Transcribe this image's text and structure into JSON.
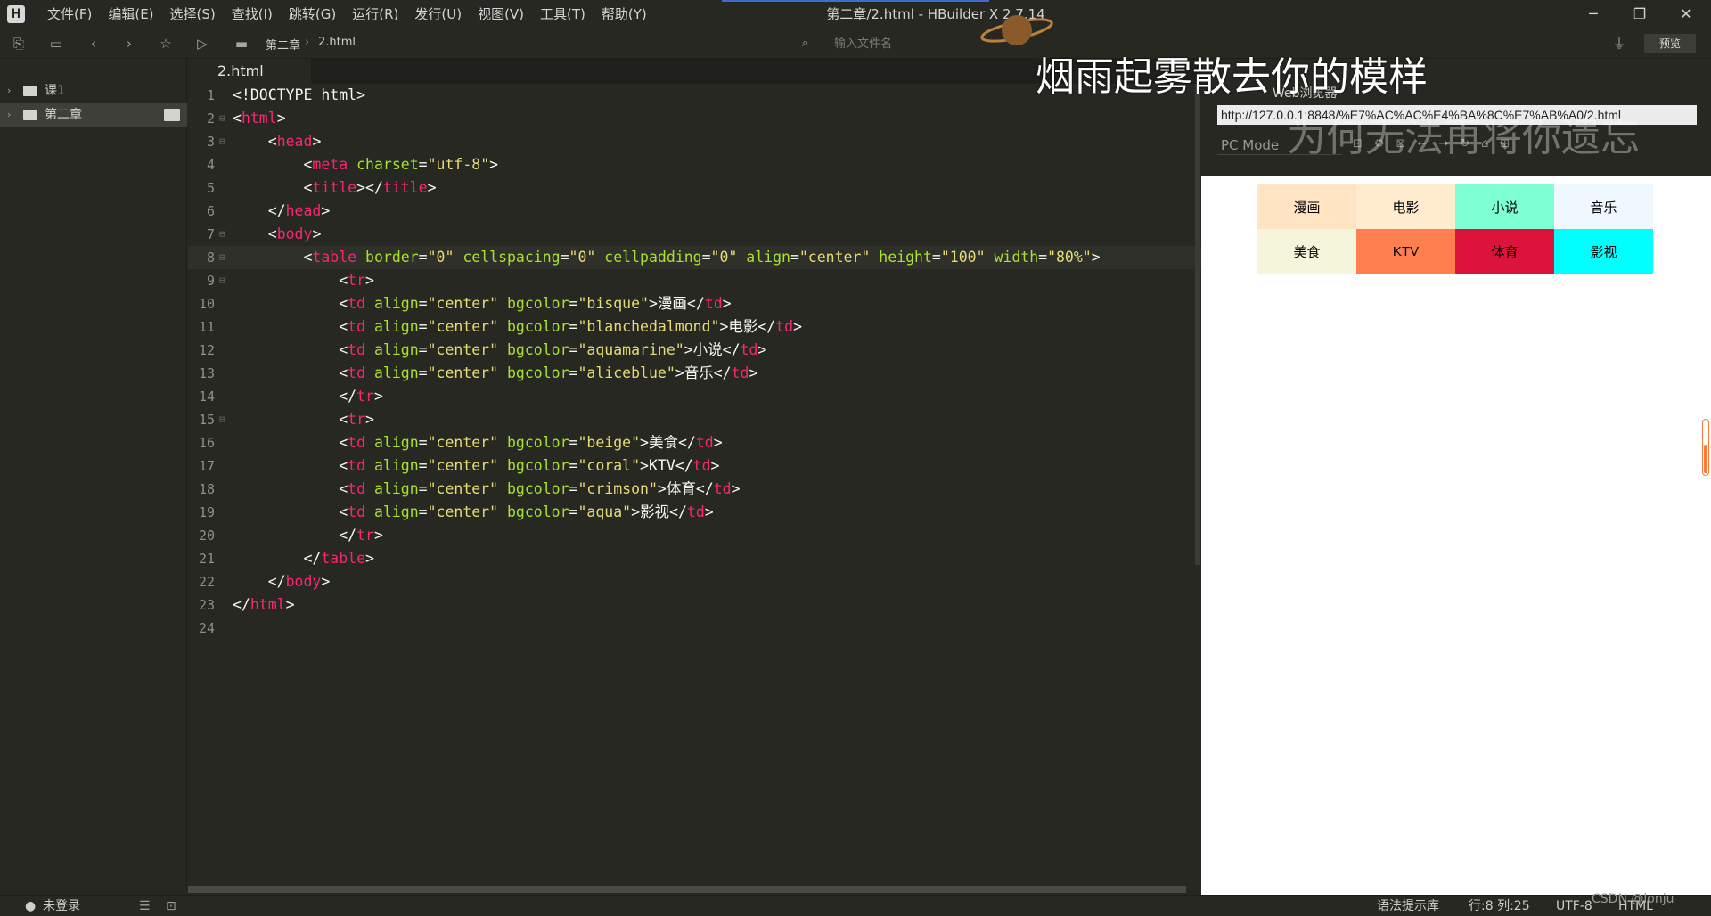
{
  "app": {
    "window_title": "第二章/2.html - HBuilder X 2.7.14",
    "menu": [
      "文件(F)",
      "编辑(E)",
      "选择(S)",
      "查找(I)",
      "跳转(G)",
      "运行(R)",
      "发行(U)",
      "视图(V)",
      "工具(T)",
      "帮助(Y)"
    ]
  },
  "toolbar": {
    "breadcrumb": [
      "第二章",
      "2.html"
    ],
    "search_placeholder": "输入文件名",
    "preview_label": "预览"
  },
  "sidebar": {
    "items": [
      {
        "label": "课1"
      },
      {
        "label": "第二章"
      }
    ]
  },
  "editor": {
    "tab_label": "2.html",
    "lines": [
      {
        "n": "1",
        "fold": ""
      },
      {
        "n": "2",
        "fold": "⊟"
      },
      {
        "n": "3",
        "fold": "⊟"
      },
      {
        "n": "4",
        "fold": ""
      },
      {
        "n": "5",
        "fold": ""
      },
      {
        "n": "6",
        "fold": ""
      },
      {
        "n": "7",
        "fold": "⊟"
      },
      {
        "n": "8",
        "fold": "⊟"
      },
      {
        "n": "9",
        "fold": "⊟"
      },
      {
        "n": "10",
        "fold": ""
      },
      {
        "n": "11",
        "fold": ""
      },
      {
        "n": "12",
        "fold": ""
      },
      {
        "n": "13",
        "fold": ""
      },
      {
        "n": "14",
        "fold": ""
      },
      {
        "n": "15",
        "fold": "⊟"
      },
      {
        "n": "16",
        "fold": ""
      },
      {
        "n": "17",
        "fold": ""
      },
      {
        "n": "18",
        "fold": ""
      },
      {
        "n": "19",
        "fold": ""
      },
      {
        "n": "20",
        "fold": ""
      },
      {
        "n": "21",
        "fold": ""
      },
      {
        "n": "22",
        "fold": ""
      },
      {
        "n": "23",
        "fold": ""
      },
      {
        "n": "24",
        "fold": ""
      }
    ],
    "code": {
      "l1": "<!DOCTYPE html>",
      "l8_attrs": [
        "border",
        "0",
        "cellspacing",
        "0",
        "cellpadding",
        "0",
        "align",
        "center",
        "height",
        "100",
        "width",
        "80%"
      ],
      "cells": [
        {
          "bgcolor": "bisque",
          "text": "漫画"
        },
        {
          "bgcolor": "blanchedalmond",
          "text": "电影"
        },
        {
          "bgcolor": "aquamarine",
          "text": "小说"
        },
        {
          "bgcolor": "aliceblue",
          "text": "音乐"
        },
        {
          "bgcolor": "beige",
          "text": "美食"
        },
        {
          "bgcolor": "coral",
          "text": "KTV"
        },
        {
          "bgcolor": "crimson",
          "text": "体育"
        },
        {
          "bgcolor": "aqua",
          "text": "影视"
        }
      ],
      "charset": "utf-8"
    }
  },
  "browser": {
    "title": "Web浏览器",
    "url": "http://127.0.0.1:8848/%E7%AC%AC%E4%BA%8C%E7%AB%A0/2.html",
    "mode": "PC Mode",
    "table_rows": [
      [
        {
          "text": "漫画",
          "bg": "#ffe4c4",
          "fg": "#000000"
        },
        {
          "text": "电影",
          "bg": "#ffebcd",
          "fg": "#000000"
        },
        {
          "text": "小说",
          "bg": "#7fffd4",
          "fg": "#000000"
        },
        {
          "text": "音乐",
          "bg": "#f0f8ff",
          "fg": "#000000"
        }
      ],
      [
        {
          "text": "美食",
          "bg": "#f5f5dc",
          "fg": "#000000"
        },
        {
          "text": "KTV",
          "bg": "#ff7f50",
          "fg": "#000000"
        },
        {
          "text": "体育",
          "bg": "#dc143c",
          "fg": "#000000"
        },
        {
          "text": "影视",
          "bg": "#00ffff",
          "fg": "#000000"
        }
      ]
    ]
  },
  "overlay": {
    "lyric_line1": "烟雨起雾散去你的模样",
    "lyric_line2": "为何无法再将你遗忘"
  },
  "status": {
    "login": "未登录",
    "syntax_lib": "语法提示库",
    "position": "行:8  列:25",
    "encoding": "UTF-8",
    "language": "HTML",
    "watermark": "CSDN @lonju"
  },
  "colors": {
    "bg": "#272822",
    "tag": "#f92672",
    "attr": "#a6e22e",
    "string": "#e6db74"
  }
}
